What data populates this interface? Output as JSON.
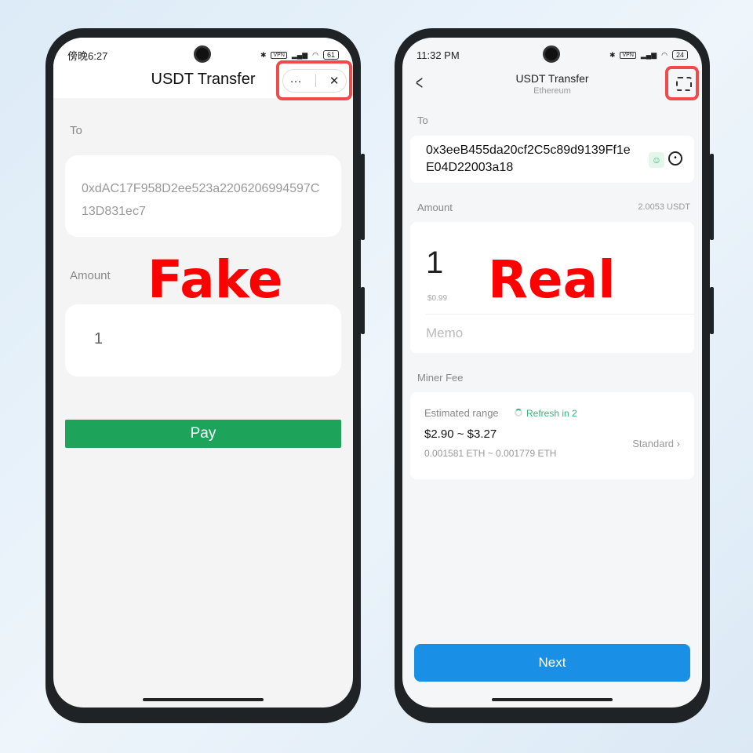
{
  "fake": {
    "status": {
      "time": "傍晚6:27",
      "battery": "61",
      "vpn": "VPN"
    },
    "title": "USDT Transfer",
    "menu_icon": "more-dots-icon",
    "close_icon": "close-icon",
    "to_label": "To",
    "address": "0xdAC17F958D2ee523a2206206994597C13D831ec7",
    "amount_label": "Amount",
    "amount": "1",
    "pay_label": "Pay",
    "overlay": "Fake",
    "colors": {
      "pay": "#1da35a",
      "overlay": "#ff0000"
    }
  },
  "real": {
    "status": {
      "time": "11:32 PM",
      "battery": "24",
      "vpn": "VPN"
    },
    "title": "USDT Transfer",
    "subtitle": "Ethereum",
    "to_label": "To",
    "address": "0x3eeB455da20cf2C5c89d9139Ff1eE04D22003a18",
    "amount_label": "Amount",
    "balance": "2.0053 USDT",
    "amount": "1",
    "amount_usd": "$0.99",
    "memo_placeholder": "Memo",
    "fee_label": "Miner Fee",
    "estimated_label": "Estimated range",
    "refresh": "Refresh in 2",
    "fee_usd": "$2.90 ~ $3.27",
    "fee_eth": "0.001581 ETH ~ 0.001779 ETH",
    "fee_level": "Standard",
    "next_label": "Next",
    "overlay": "Real",
    "colors": {
      "next": "#1a8fe6",
      "refresh": "#3bb37a"
    }
  }
}
